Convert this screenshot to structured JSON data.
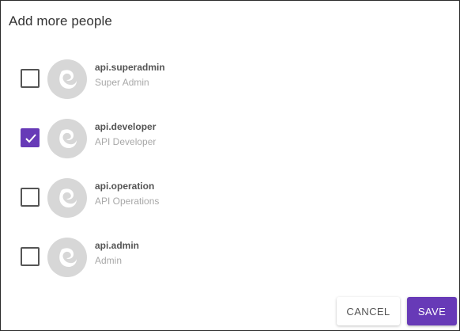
{
  "dialog": {
    "title": "Add more people"
  },
  "people": [
    {
      "name": "api.superadmin",
      "role": "Super Admin",
      "checked": false
    },
    {
      "name": "api.developer",
      "role": "API Developer",
      "checked": true
    },
    {
      "name": "api.operation",
      "role": "API Operations",
      "checked": false
    },
    {
      "name": "api.admin",
      "role": "Admin",
      "checked": false
    }
  ],
  "actions": {
    "cancel_label": "CANCEL",
    "save_label": "SAVE"
  },
  "colors": {
    "accent": "#673ab7",
    "avatar_bg": "#d7d7d7"
  },
  "icons": {
    "avatar": "default-avatar-icon",
    "check": "check-icon"
  }
}
